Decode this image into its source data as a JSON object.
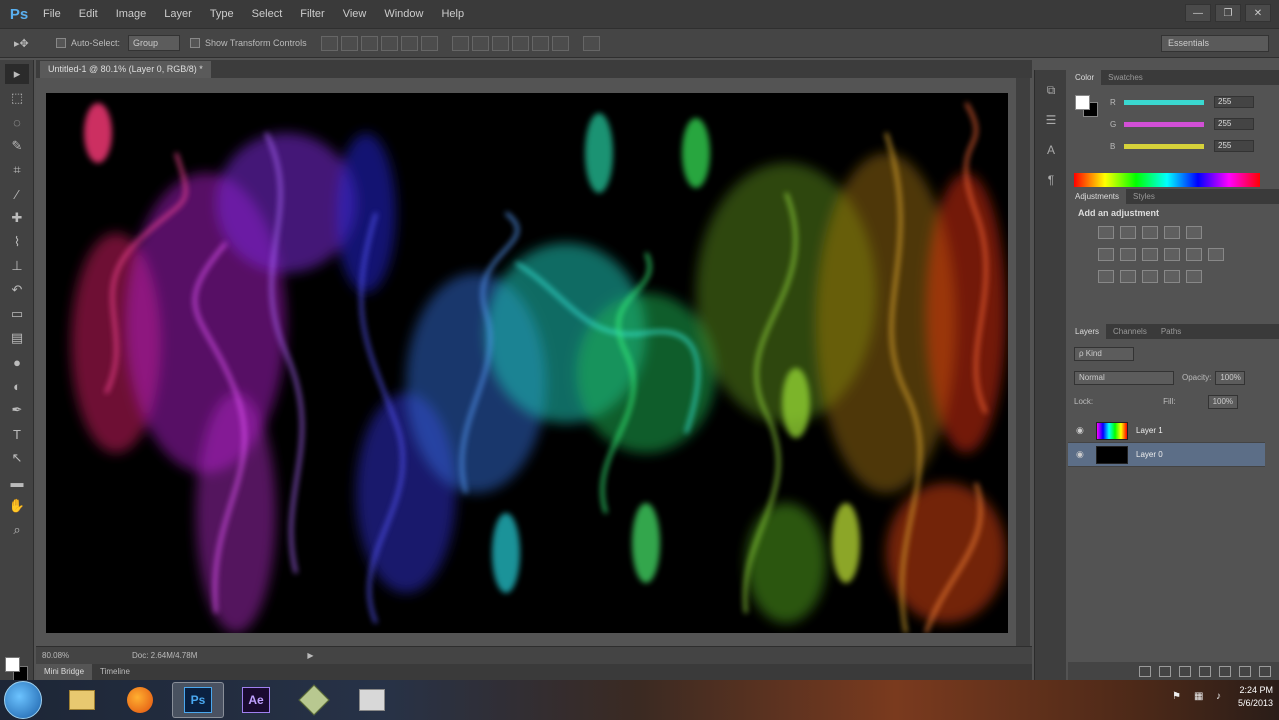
{
  "app": {
    "logo": "Ps"
  },
  "menu": [
    "File",
    "Edit",
    "Image",
    "Layer",
    "Type",
    "Select",
    "Filter",
    "View",
    "Window",
    "Help"
  ],
  "window_controls": {
    "minimize": "—",
    "restore": "❐",
    "close": "✕"
  },
  "options_bar": {
    "tool_icon": "move-tool-icon",
    "auto_select_label": "Auto-Select:",
    "auto_select_value": "Group",
    "transform_controls_label": "Show Transform Controls",
    "workspace_value": "Essentials"
  },
  "document": {
    "tab_title": "Untitled-1 @ 80.1% (Layer 0, RGB/8) *",
    "zoom": "80.08%",
    "doc_size": "Doc: 2.64M/4.78M"
  },
  "bottom_tabs": [
    "Mini Bridge",
    "Timeline"
  ],
  "color_panel": {
    "tabs": [
      "Color",
      "Swatches"
    ],
    "rows": [
      {
        "label": "R",
        "value": "255",
        "color": "#3ad8d0"
      },
      {
        "label": "G",
        "value": "255",
        "color": "#d24fd6"
      },
      {
        "label": "B",
        "value": "255",
        "color": "#d6d23a"
      }
    ]
  },
  "adjustments_panel": {
    "tabs": [
      "Adjustments",
      "Styles"
    ],
    "title": "Add an adjustment"
  },
  "layers_panel": {
    "tabs": [
      "Layers",
      "Channels",
      "Paths"
    ],
    "kind_filter": "ρ Kind",
    "blend_mode": "Normal",
    "opacity_label": "Opacity:",
    "opacity_value": "100%",
    "lock_label": "Lock:",
    "fill_label": "Fill:",
    "fill_value": "100%",
    "layers": [
      {
        "name": "Layer 1",
        "selected": false
      },
      {
        "name": "Layer 0",
        "selected": true
      }
    ]
  },
  "taskbar": {
    "apps": [
      "folder",
      "firefox",
      "Ps",
      "Ae",
      "app5",
      "app6"
    ],
    "time": "2:24 PM",
    "date": "5/6/2013"
  }
}
